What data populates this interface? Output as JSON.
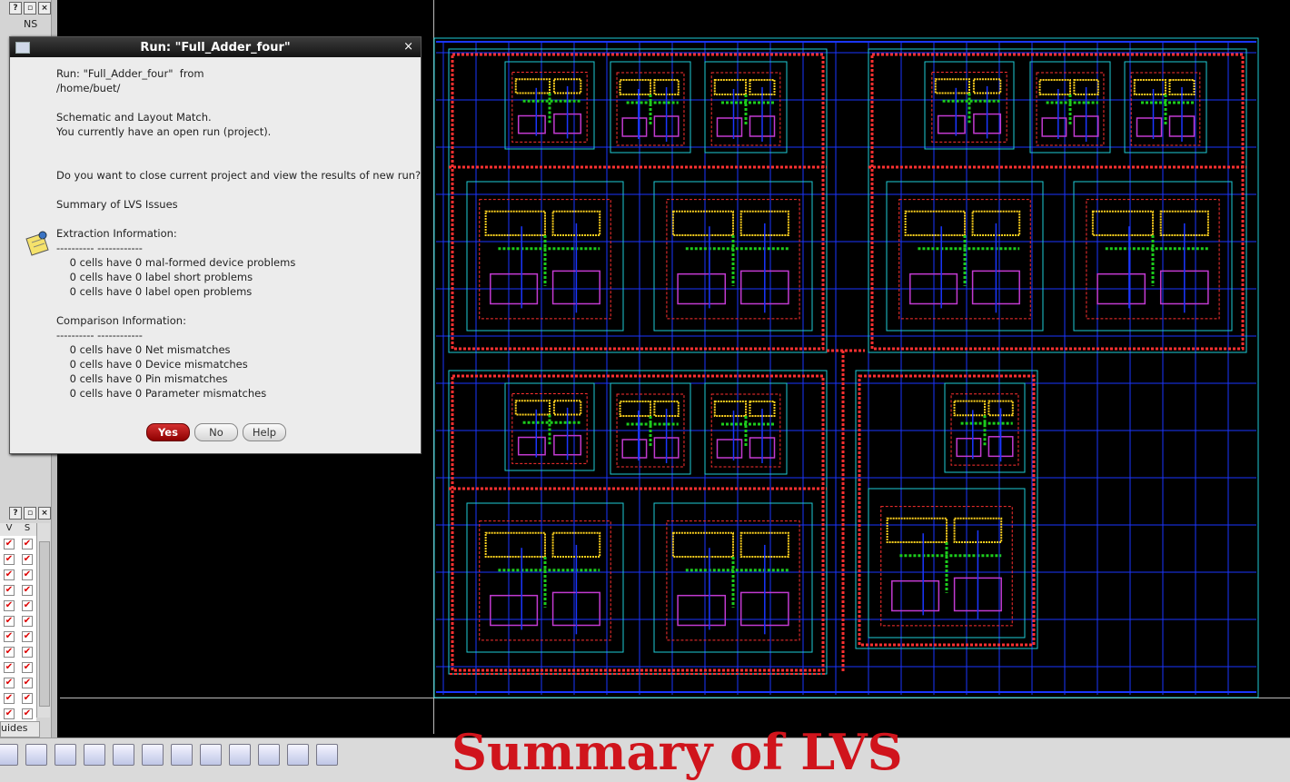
{
  "left_panel": {
    "top_header_label": "NS",
    "guides_tab_label": "uides"
  },
  "vs_table": {
    "col_v": "V",
    "col_s": "S",
    "check_glyph": "✔"
  },
  "dialog": {
    "title": "Run: \"Full_Adder_four\"",
    "close_glyph": "×",
    "lines": [
      "Run: \"Full_Adder_four\"  from",
      "/home/buet/",
      "",
      "Schematic and Layout Match.",
      "You currently have an open run (project).",
      "",
      "",
      "Do you want to close current project and view the results of new run?",
      "",
      "Summary of LVS Issues",
      "",
      "Extraction Information:",
      "---------- ------------",
      "    0 cells have 0 mal-formed device problems",
      "    0 cells have 0 label short problems",
      "    0 cells have 0 label open problems",
      "",
      "Comparison Information:",
      "---------- ------------",
      "    0 cells have 0 Net mismatches",
      "    0 cells have 0 Device mismatches",
      "    0 cells have 0 Pin mismatches",
      "    0 cells have 0 Parameter mismatches"
    ],
    "buttons": {
      "yes": "Yes",
      "no": "No",
      "help": "Help"
    },
    "icon": "info-note-icon"
  },
  "caption": "Summary of LVS",
  "colors": {
    "metal1": "#1a36ff",
    "metal2": "#e01c1c",
    "poly": "#ff3030",
    "active": "#1ccc1c",
    "contact": "#ffd21e",
    "boundary": "#1ecbd6",
    "device": "#c23ad0",
    "caption": "#d0141c",
    "primary_button": "#b00000"
  }
}
